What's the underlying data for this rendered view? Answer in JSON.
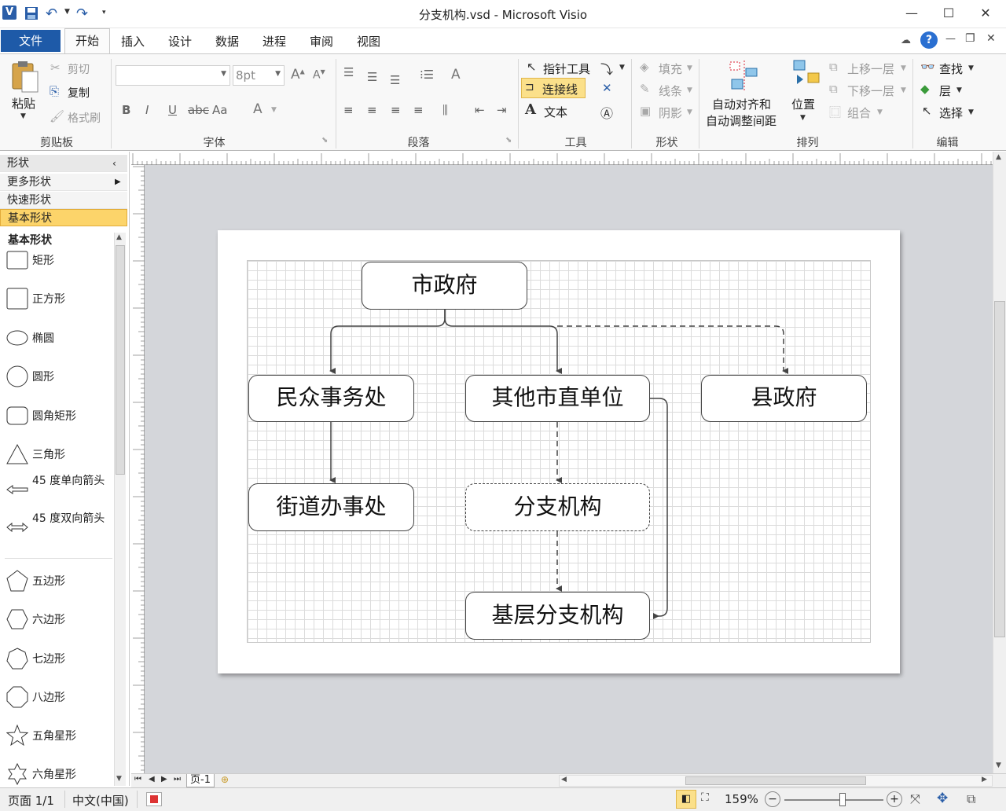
{
  "window": {
    "title": "分支机构.vsd  -  Microsoft Visio"
  },
  "quick_access": {
    "app_icon": "V",
    "save_icon": "save-icon",
    "undo_icon": "undo-icon",
    "redo_icon": "redo-icon"
  },
  "tabs": [
    {
      "label": "文件"
    },
    {
      "label": "开始"
    },
    {
      "label": "插入"
    },
    {
      "label": "设计"
    },
    {
      "label": "数据"
    },
    {
      "label": "进程"
    },
    {
      "label": "审阅"
    },
    {
      "label": "视图"
    }
  ],
  "ribbon": {
    "clipboard": {
      "paste": "粘贴",
      "cut": "剪切",
      "copy": "复制",
      "format_painter": "格式刷",
      "label": "剪贴板"
    },
    "font": {
      "font_name": "",
      "font_size": "8pt",
      "label": "字体",
      "bold": "B",
      "italic": "I",
      "underline": "U",
      "strike": "abc",
      "case": "Aa"
    },
    "paragraph": {
      "label": "段落"
    },
    "tools": {
      "pointer": "指针工具",
      "connector": "连接线",
      "text": "文本",
      "label": "工具"
    },
    "shape": {
      "fill": "填充",
      "line": "线条",
      "shadow": "阴影",
      "label": "形状"
    },
    "arrange": {
      "auto_align_1": "自动对齐和",
      "auto_align_2": "自动调整间距",
      "position": "位置",
      "bring_forward": "上移一层",
      "send_backward": "下移一层",
      "group": "组合",
      "label": "排列"
    },
    "edit": {
      "find": "查找",
      "layers": "层",
      "select": "选择",
      "label": "编辑"
    }
  },
  "sidebar": {
    "header": "形状",
    "more_shapes": "更多形状",
    "quick_shapes": "快速形状",
    "basic_shapes": "基本形状",
    "section_title": "基本形状",
    "shapes": [
      {
        "label": "矩形",
        "icon": "rectangle-icon"
      },
      {
        "label": "正方形",
        "icon": "square-icon"
      },
      {
        "label": "椭圆",
        "icon": "ellipse-icon"
      },
      {
        "label": "圆形",
        "icon": "circle-icon"
      },
      {
        "label": "圆角矩形",
        "icon": "rounded-rectangle-icon"
      },
      {
        "label": "三角形",
        "icon": "triangle-icon"
      },
      {
        "label": "45 度单向箭头",
        "icon": "single-arrow-icon"
      },
      {
        "label": "45 度双向箭头",
        "icon": "double-arrow-icon"
      },
      {
        "label": "五边形",
        "icon": "pentagon-icon"
      },
      {
        "label": "六边形",
        "icon": "hexagon-icon"
      },
      {
        "label": "七边形",
        "icon": "heptagon-icon"
      },
      {
        "label": "八边形",
        "icon": "octagon-icon"
      },
      {
        "label": "五角星形",
        "icon": "five-star-icon"
      },
      {
        "label": "六角星形",
        "icon": "six-star-icon"
      }
    ]
  },
  "diagram": {
    "nodes": {
      "city_gov": "市政府",
      "public_affairs": "民众事务处",
      "other_units": "其他市直单位",
      "county_gov": "县政府",
      "street_office": "街道办事处",
      "branch": "分支机构",
      "grassroots_branch": "基层分支机构"
    }
  },
  "page_tabs": {
    "current": "页-1"
  },
  "status": {
    "page": "页面 1/1",
    "language": "中文(中国)",
    "zoom": "159%"
  }
}
